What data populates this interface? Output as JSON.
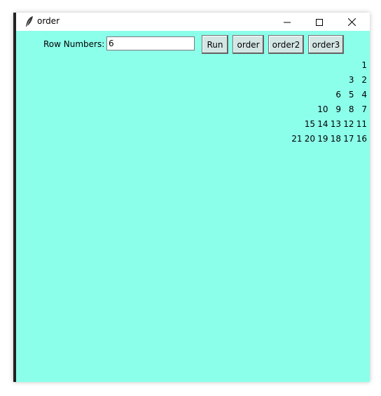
{
  "window": {
    "title": "order"
  },
  "toolbar": {
    "row_label": "Row Numbers:",
    "row_value": "6",
    "run_label": "Run",
    "order_label": "order",
    "order2_label": "order2",
    "order3_label": "order3"
  },
  "colors": {
    "background": "#8cffea",
    "button": "#d4e6e3"
  },
  "icons": {
    "app": "feather-icon",
    "minimize": "minimize-icon",
    "maximize": "maximize-icon",
    "close": "close-icon"
  },
  "rows": [
    [
      "1"
    ],
    [
      "3",
      "2"
    ],
    [
      "6",
      "5",
      "4"
    ],
    [
      "10",
      "9",
      "8",
      "7"
    ],
    [
      "15",
      "14",
      "13",
      "12",
      "11"
    ],
    [
      "21",
      "20",
      "19",
      "18",
      "17",
      "16"
    ]
  ]
}
